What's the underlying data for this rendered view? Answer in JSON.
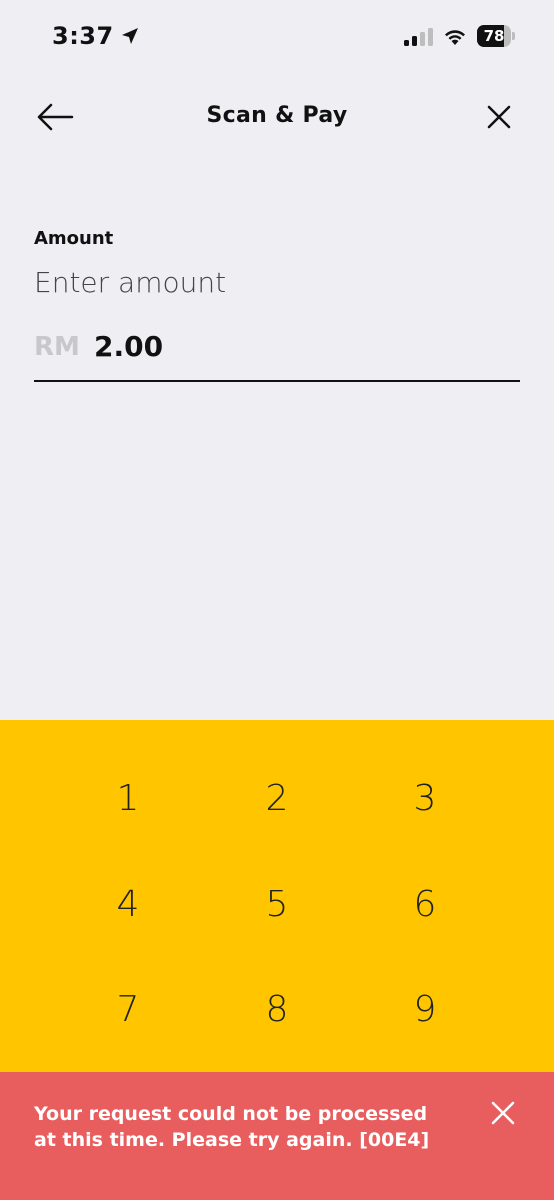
{
  "status_bar": {
    "time": "3:37",
    "battery": "78",
    "battery_level": 0.78
  },
  "header": {
    "title": "Scan & Pay"
  },
  "amount": {
    "label": "Amount",
    "placeholder": "Enter amount",
    "currency": "RM",
    "value": "2.00"
  },
  "keypad": {
    "keys": [
      "1",
      "2",
      "3",
      "4",
      "5",
      "6",
      "7",
      "8",
      "9"
    ]
  },
  "toast": {
    "message": "Your request could not be processed at this time. Please try again. [00E4]"
  },
  "colors": {
    "background": "#EFEEF3",
    "keypad": "#FFC600",
    "toast": "#E85E5E"
  }
}
